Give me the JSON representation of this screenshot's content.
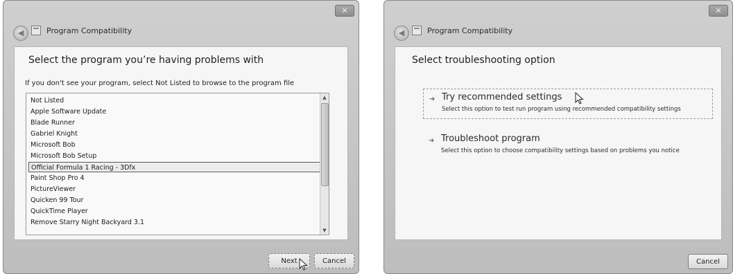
{
  "left_window": {
    "title": "Program Compatibility",
    "close_label": "✕",
    "heading": "Select the program you’re having problems with",
    "instruction": "If you don't see your program, select Not Listed to browse to the program file",
    "programs": [
      "Not Listed",
      "Apple Software Update",
      "Blade Runner",
      "Gabriel Knight",
      "Microsoft Bob",
      "Microsoft Bob Setup",
      "Official Formula 1 Racing - 3Dfx",
      "Paint Shop Pro 4",
      "PictureViewer",
      "Quicken 99 Tour",
      "QuickTime Player",
      "Remove Starry Night Backyard 3.1"
    ],
    "selected_program": "Official Formula 1 Racing - 3Dfx",
    "next_label": "Next",
    "cancel_label": "Cancel"
  },
  "right_window": {
    "title": "Program Compatibility",
    "close_label": "✕",
    "heading": "Select troubleshooting option",
    "options": [
      {
        "title": "Try recommended settings",
        "description": "Select this option to test run program using recommended compatibility settings"
      },
      {
        "title": "Troubleshoot program",
        "description": "Select this option to choose compatibility settings based on problems you notice"
      }
    ],
    "cancel_label": "Cancel"
  },
  "icons": [
    "back-arrow-icon",
    "program-compatibility-icon",
    "close-icon",
    "option-arrow-icon",
    "scroll-up-icon",
    "scroll-down-icon",
    "mouse-cursor-icon"
  ],
  "colors": {
    "window_frame": "#c8c8c8",
    "content_bg": "#f6f6f6",
    "text": "#1e1e1e"
  }
}
